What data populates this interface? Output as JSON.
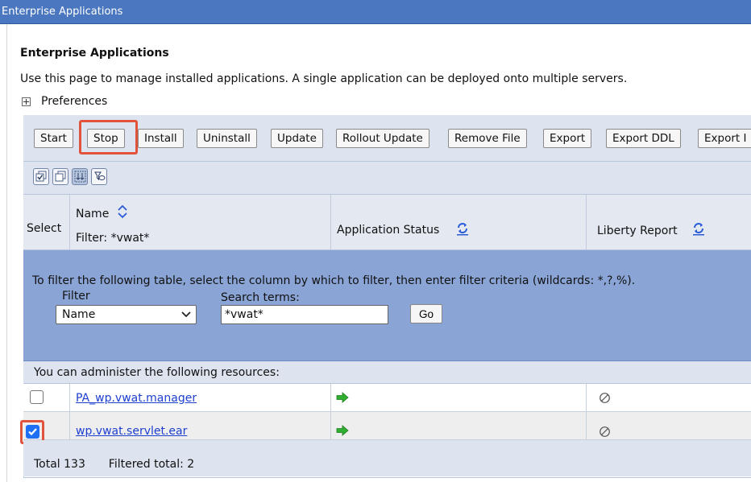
{
  "window": {
    "title": "Enterprise Applications"
  },
  "page": {
    "heading": "Enterprise Applications",
    "description": "Use this page to manage installed applications. A single application can be deployed onto multiple servers.",
    "preferences_label": "Preferences"
  },
  "toolbar": {
    "buttons": [
      "Start",
      "Stop",
      "Install",
      "Uninstall",
      "Update",
      "Rollout Update",
      "Remove File",
      "Export",
      "Export DDL",
      "Export I"
    ]
  },
  "table": {
    "columns": {
      "select": "Select",
      "name": "Name",
      "filter_status": "Filter: *vwat*",
      "app_status": "Application Status",
      "liberty": "Liberty Report"
    },
    "filter_panel": {
      "instructions": "To filter the following table, select the column by which to filter, then enter filter criteria (wildcards: *,?,%).",
      "filter_label": "Filter",
      "filter_value": "Name",
      "search_label": "Search terms:",
      "search_value": "*vwat*",
      "go_label": "Go"
    },
    "resources_label": "You can administer the following resources:",
    "rows": [
      {
        "name": "PA_wp.vwat.manager",
        "checked": false,
        "status": "started",
        "liberty": "not-applicable"
      },
      {
        "name": "wp.vwat.servlet.ear",
        "checked": true,
        "status": "started",
        "liberty": "not-applicable"
      }
    ],
    "footer": {
      "total": "Total 133",
      "filtered": "Filtered total: 2"
    }
  },
  "colors": {
    "titlebar": "#4a77c0",
    "filter_panel": "#8aa4d5",
    "highlight": "#e2533e",
    "checkbox": "#1f6ff5",
    "status_green": "#2fae2f"
  }
}
